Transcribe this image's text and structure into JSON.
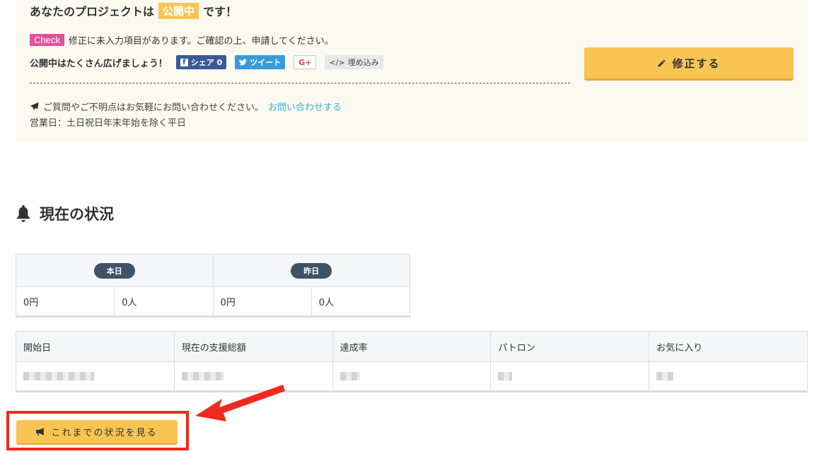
{
  "notice": {
    "title_prefix": "あなたのプロジェクトは",
    "badge": "公開中",
    "title_suffix": "です！",
    "check_label": "Check",
    "check_message": "修正に未入力項目があります。ご確認の上、申請してください。",
    "share_prompt": "公開中はたくさん広げましょう！",
    "share_fb": "シェア 0",
    "share_tw": "ツイート",
    "share_gplus": "G+",
    "share_embed": "埋め込み",
    "inquiry_text": "ご質問やご不明点はお気軽にお問い合わせください。",
    "inquiry_link": "お問い合わせする",
    "business_hours": "営業日：土日祝日年末年始を除く平日",
    "edit_button": "修正する"
  },
  "status": {
    "heading": "現在の状況",
    "today_label": "本日",
    "yesterday_label": "昨日",
    "today_yen": "0円",
    "today_people": "0人",
    "yesterday_yen": "0円",
    "yesterday_people": "0人",
    "columns": [
      "開始日",
      "現在の支援総額",
      "達成率",
      "パトロン",
      "お気に入り"
    ],
    "history_button": "これまでの状況を見る"
  },
  "colors": {
    "accent_yellow": "#f8c554",
    "check_pink": "#e4509a",
    "pill_navy": "#3e5268",
    "highlight_red": "#ee2a1f"
  }
}
